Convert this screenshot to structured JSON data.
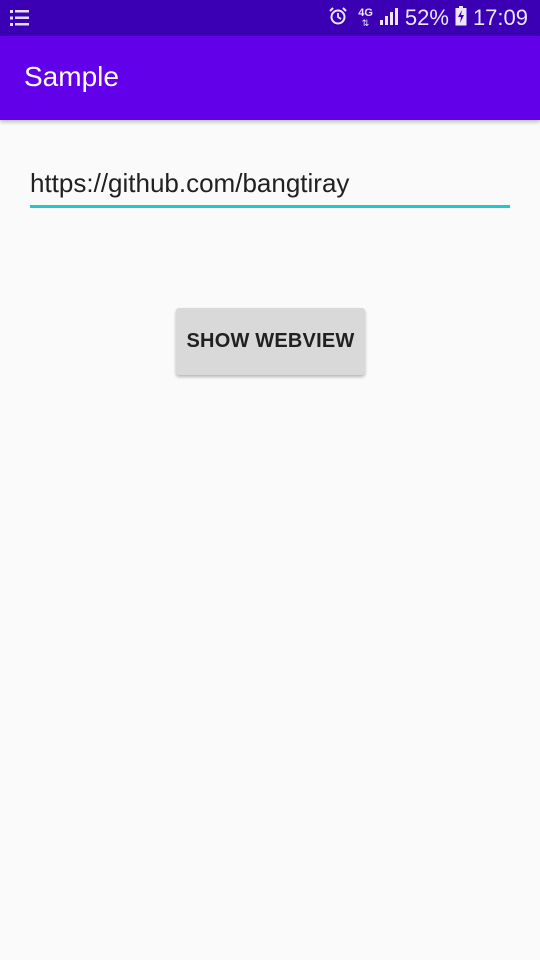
{
  "status_bar": {
    "battery": "52%",
    "time": "17:09",
    "network": "4G",
    "icons": [
      "menu-list-icon",
      "alarm-icon",
      "network-4g-icon",
      "signal-icon",
      "battery-charging-icon"
    ]
  },
  "app_bar": {
    "title": "Sample"
  },
  "form": {
    "url_value": "https://github.com/bangtiray",
    "button_label": "SHOW WEBVIEW"
  },
  "colors": {
    "status_bar": "#3b00b3",
    "app_bar": "#6200ea",
    "accent": "#1ec9c9",
    "button": "#d9d9d9",
    "background": "#fafafa"
  }
}
